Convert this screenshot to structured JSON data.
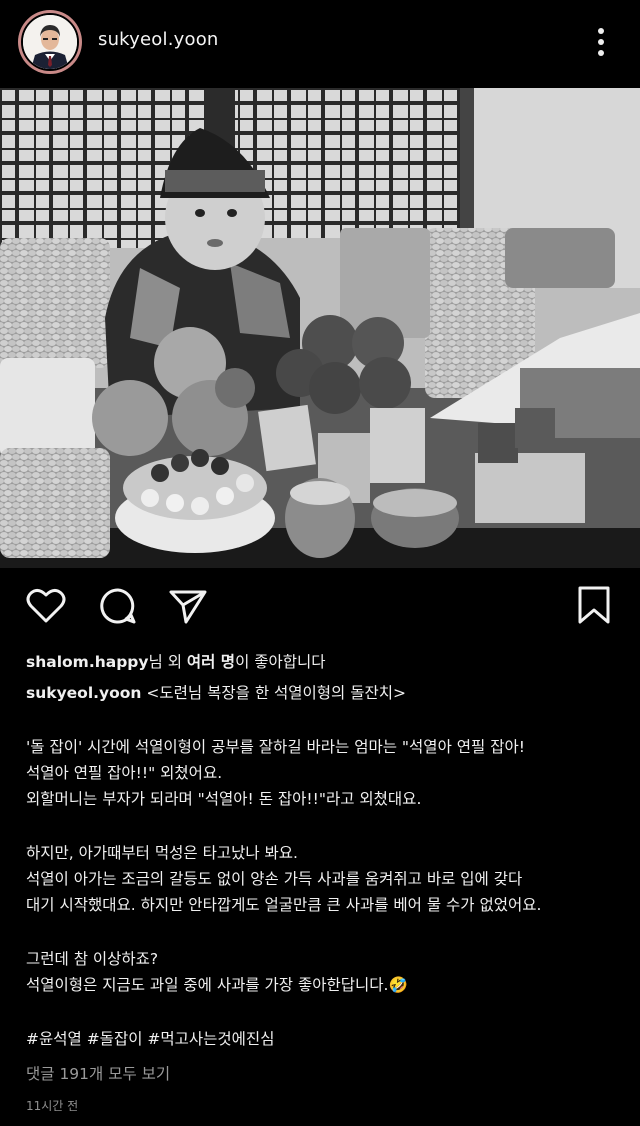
{
  "header": {
    "username": "sukyeol.yoon",
    "avatar_icon": "profile-photo",
    "more_icon": "more-vertical-icon"
  },
  "actions": {
    "like_icon": "heart-icon",
    "comment_icon": "comment-icon",
    "share_icon": "send-icon",
    "save_icon": "bookmark-icon"
  },
  "likes": {
    "user": "shalom.happy",
    "mid": "님 외 ",
    "others": "여러 명",
    "tail": "이 좋아합니다"
  },
  "caption": {
    "username": "sukyeol.yoon",
    "title": " <도련님 복장을 한 석열이형의 돌잔치>",
    "lines": [
      "'돌 잡이' 시간에 석열이형이 공부를 잘하길 바라는 엄마는 \"석열아 연필 잡아!",
      "석열아 연필 잡아!!\" 외쳤어요.",
      "외할머니는 부자가 되라며 \"석열아! 돈 잡아!!\"라고 외쳤대요.",
      "하지만, 아가때부터 먹성은 타고났나 봐요.",
      "석열이 아가는 조금의 갈등도 없이 양손 가득 사과를 움켜쥐고 바로 입에 갖다",
      "대기 시작했대요. 하지만 안타깝게도 얼굴만큼 큰 사과를 베어 물 수가 없었어요.",
      "그런데 참 이상하죠?",
      "석열이형은 지금도 과일 중에 사과를 가장 좋아한답니다."
    ],
    "emoji": "🤣",
    "hashtags": "#윤석열 #돌잡이 #먹고사는것에진심"
  },
  "comments_link": "댓글 191개 모두 보기",
  "timestamp": "11시간 전",
  "colors": {
    "background": "#000000",
    "text": "#f0f0f0",
    "muted": "#9a9a9a",
    "avatar_ring": "#c98a88"
  }
}
